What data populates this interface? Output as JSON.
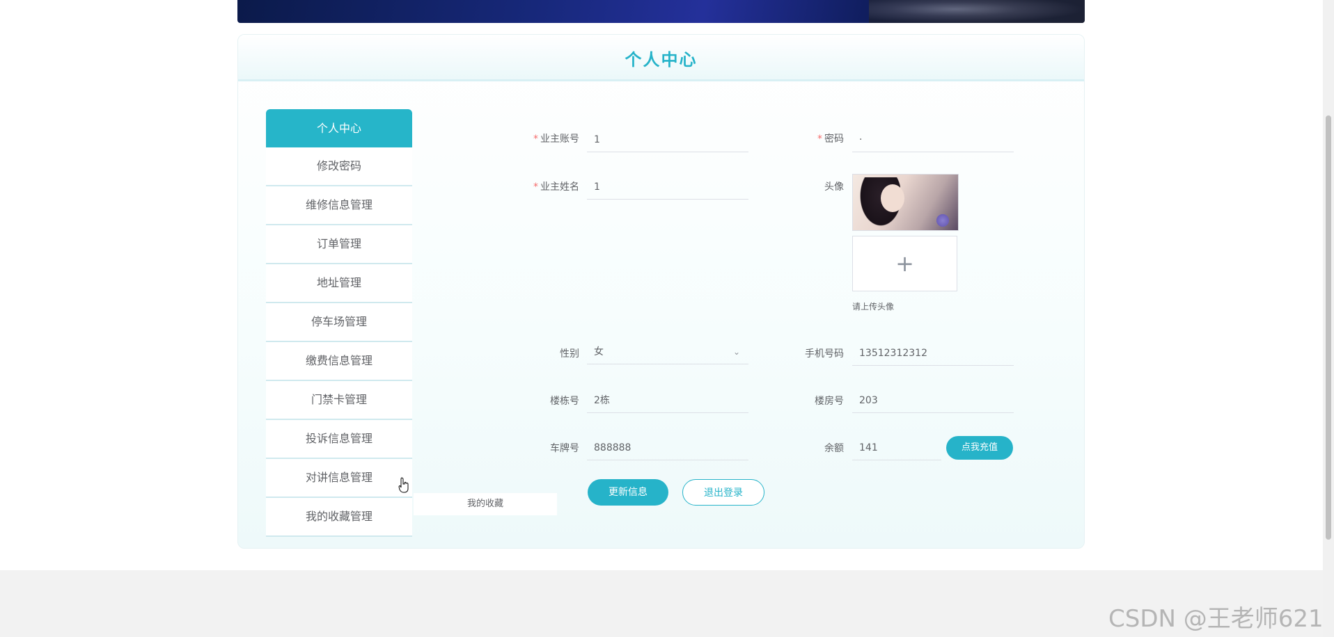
{
  "page": {
    "title": "个人中心"
  },
  "menu": {
    "items": [
      {
        "label": "个人中心"
      },
      {
        "label": "修改密码"
      },
      {
        "label": "维修信息管理"
      },
      {
        "label": "订单管理"
      },
      {
        "label": "地址管理"
      },
      {
        "label": "停车场管理"
      },
      {
        "label": "缴费信息管理"
      },
      {
        "label": "门禁卡管理"
      },
      {
        "label": "投诉信息管理"
      },
      {
        "label": "对讲信息管理"
      },
      {
        "label": "我的收藏管理"
      }
    ],
    "tooltip": "我的收藏"
  },
  "form": {
    "account_label": "业主账号",
    "account_value": "1",
    "password_label": "密码",
    "password_value": "·",
    "name_label": "业主姓名",
    "name_value": "1",
    "avatar_label": "头像",
    "upload_icon": "+",
    "upload_tip": "请上传头像",
    "gender_label": "性别",
    "gender_value": "女",
    "gender_arrow": "⌄",
    "phone_label": "手机号码",
    "phone_value": "13512312312",
    "building_label": "楼栋号",
    "building_value": "2栋",
    "room_label": "楼房号",
    "room_value": "203",
    "plate_label": "车牌号",
    "plate_value": "888888",
    "balance_label": "余额",
    "balance_value": "141",
    "required_mark": "*"
  },
  "buttons": {
    "recharge": "点我充值",
    "update": "更新信息",
    "logout": "退出登录"
  },
  "watermark": "CSDN @王老师621",
  "colors": {
    "accent": "#26b3c9",
    "required": "#f56c6c"
  }
}
